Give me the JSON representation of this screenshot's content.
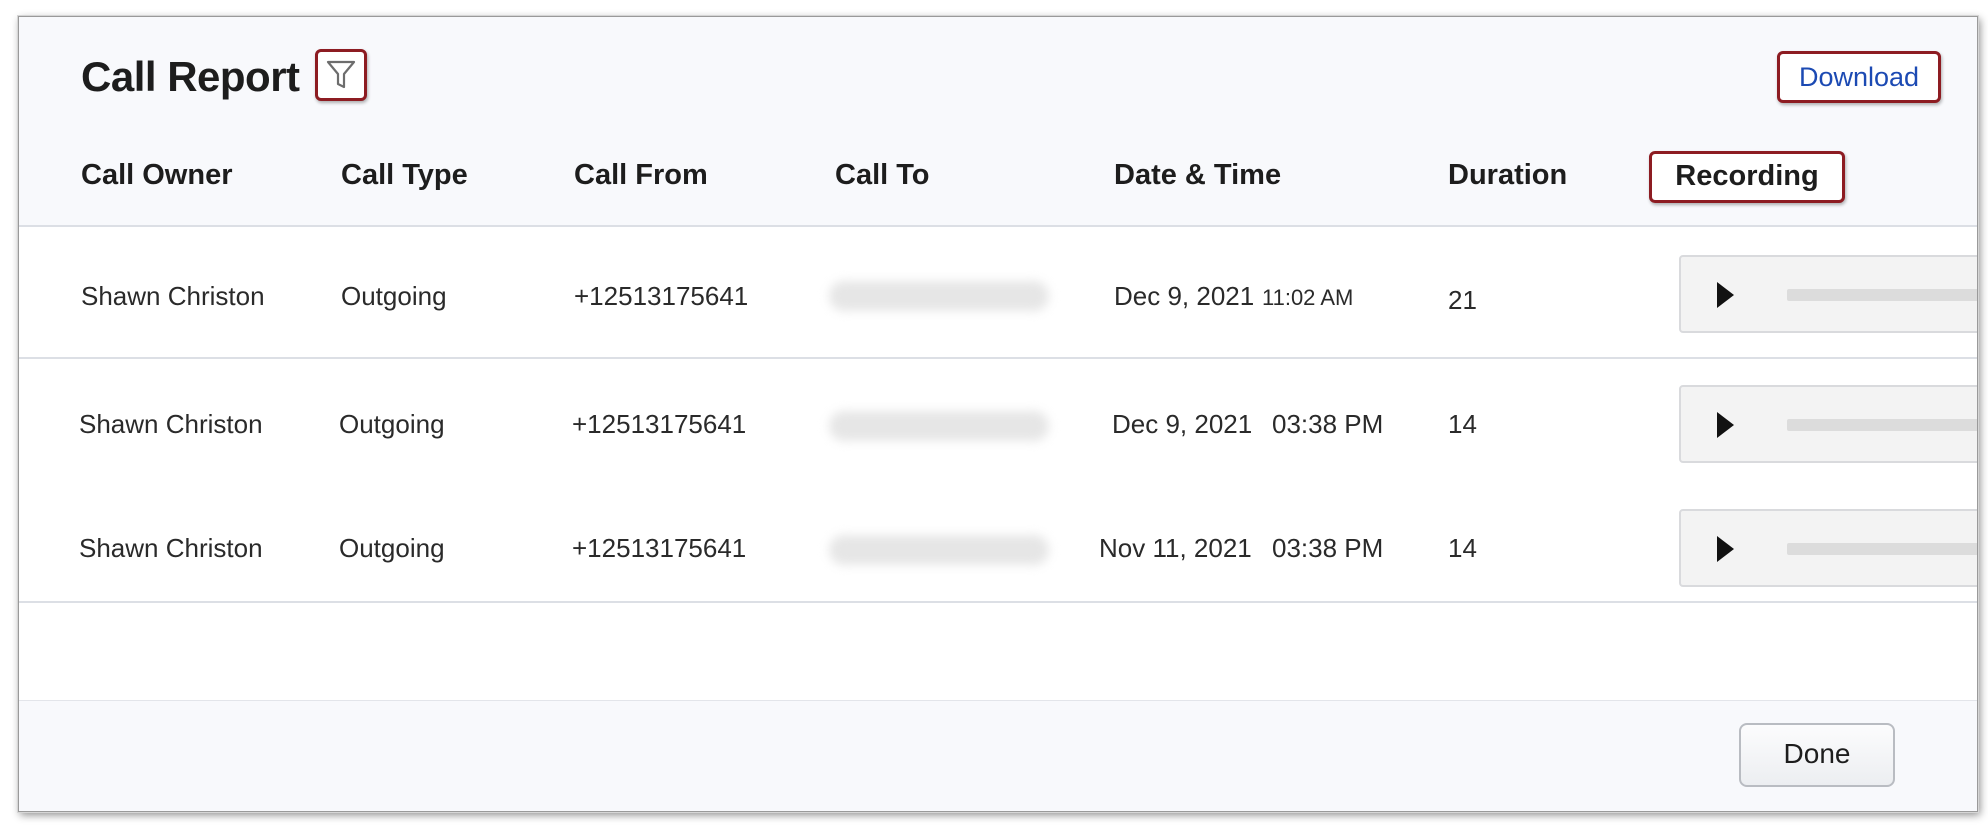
{
  "header": {
    "title": "Call Report",
    "filter_icon": "filter-funnel-icon",
    "download_label": "Download",
    "highlight_color": "#8d1c22",
    "link_color": "#1c4ab3"
  },
  "columns": [
    "Call Owner",
    "Call Type",
    "Call From",
    "Call To",
    "Date & Time",
    "Duration",
    "Recording"
  ],
  "rows": [
    {
      "owner": "Shawn Christon",
      "type": "Outgoing",
      "from": "+12513175641",
      "date": "Dec 9, 2021",
      "time": "11:02 AM",
      "duration": "21"
    },
    {
      "owner": "Shawn Christon",
      "type": "Outgoing",
      "from": "+12513175641",
      "date": "Dec 9, 2021",
      "time": "03:38 PM",
      "duration": "14"
    },
    {
      "owner": "Shawn Christon",
      "type": "Outgoing",
      "from": "+12513175641",
      "date": "Nov 11, 2021",
      "time": "03:38 PM",
      "duration": "14"
    }
  ],
  "footer": {
    "done_label": "Done"
  }
}
